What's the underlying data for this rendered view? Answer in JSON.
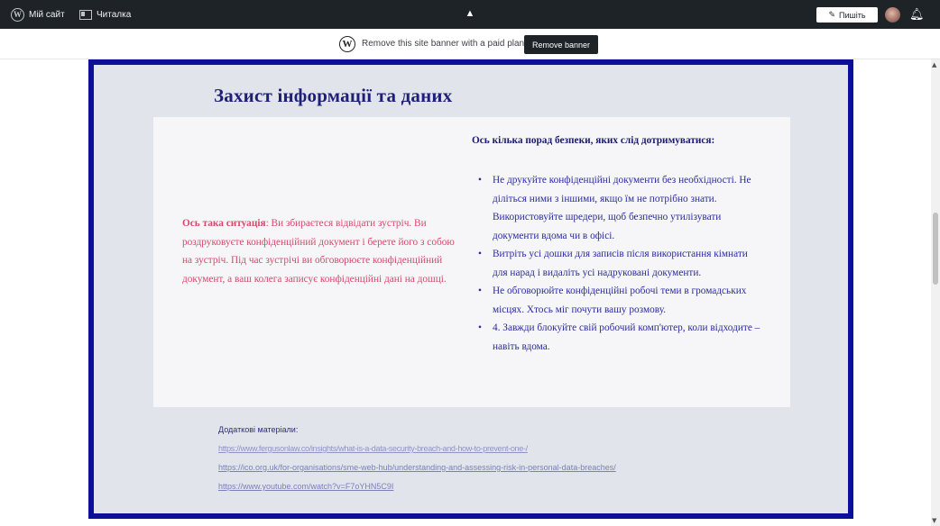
{
  "adminbar": {
    "my_site": "Мій сайт",
    "reader": "Читалка",
    "write": "Пишіть"
  },
  "banner": {
    "text": "Remove this site banner with a paid plan",
    "button": "Remove banner"
  },
  "page": {
    "title": "Захист інформації та даних",
    "situation_label": "Ось така ситуація",
    "situation_text": ": Ви збираєтеся відвідати зустріч. Ви роздруковуєте конфіденційний документ і берете його з собою на зустріч. Під час зустрічі ви обговорюєте конфіденційний документ, а ваш колега записує конфіденційні дані на дошці.",
    "tips_heading": "Ось кілька порад безпеки, яких слід дотримуватися:",
    "tips": [
      "Не друкуйте конфіденційні документи без необхідності. Не діліться ними з іншими, якщо їм не потрібно знати. Використовуйте шредери, щоб безпечно утилізувати документи вдома чи в офісі.",
      "Витріть усі дошки для записів після використання кімнати для нарад і видаліть усі надруковані документи.",
      "Не обговорюйте конфіденційні робочі теми в громадських місцях. Хтось міг почути вашу розмову.",
      "4. Завжди блокуйте свій робочий комп'ютер, коли відходите – навіть вдома."
    ],
    "extra_label": "Додаткові матеріали:",
    "links": [
      "https://www.fergusonlaw.co/insights/what-is-a-data-security-breach-and-how-to-prevent-one-/",
      "https://ico.org.uk/for-organisations/sme-web-hub/understanding-and-assessing-risk-in-personal-data-breaches/",
      "https://www.youtube.com/watch?v=F7oYHN5C9I"
    ]
  }
}
